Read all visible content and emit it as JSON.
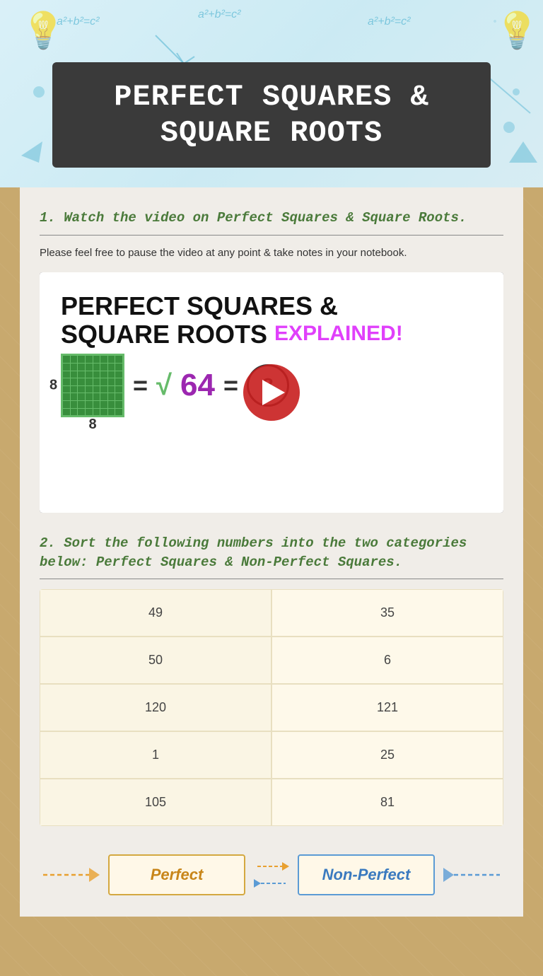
{
  "header": {
    "title_line1": "Perfect Squares &",
    "title_line2": "Square Roots",
    "background_note": "math doodles background"
  },
  "section1": {
    "heading": "1. Watch the video on Perfect Squares & Square Roots.",
    "description": "Please feel free to pause the video at any point & take notes in your notebook.",
    "video": {
      "title_line1": "PERFECT SQUARES &",
      "title_line2": "SQUARE ROOTS",
      "explained_label": "EXPLAINED!",
      "play_button_label": "Play Video",
      "equation_label": "8² = √64 = 8"
    }
  },
  "section2": {
    "heading": "2. Sort the following numbers into the two categories below: Perfect Squares & Non-Perfect Squares.",
    "numbers": [
      {
        "left": "49",
        "right": "35"
      },
      {
        "left": "50",
        "right": "6"
      },
      {
        "left": "120",
        "right": "121"
      },
      {
        "left": "1",
        "right": "25"
      },
      {
        "left": "105",
        "right": "81"
      }
    ]
  },
  "categories": {
    "perfect_label": "Perfect",
    "non_perfect_label": "Non-Perfect"
  }
}
